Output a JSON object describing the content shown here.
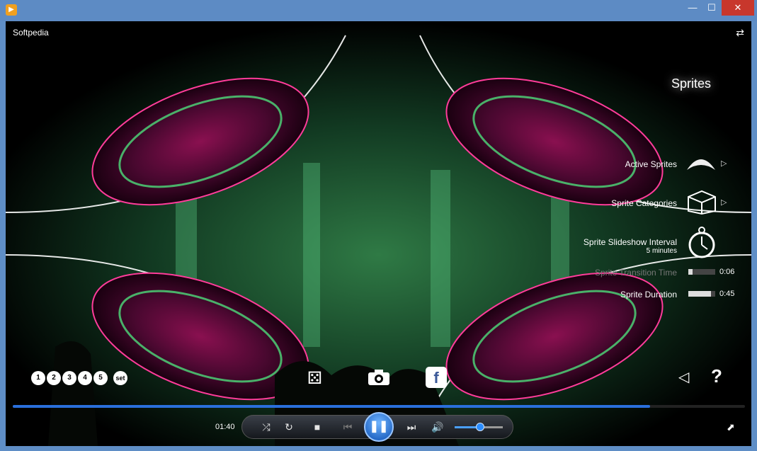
{
  "window": {
    "app_title": "Softpedia"
  },
  "panel": {
    "title": "Sprites",
    "active_sprites": "Active Sprites",
    "sprite_categories": "Sprite Categories",
    "slideshow_interval": "Sprite Slideshow Interval",
    "slideshow_interval_value": "5 minutes",
    "transition_time": "Sprite Transition Time",
    "transition_time_value": "0:06",
    "transition_fraction": 0.15,
    "duration": "Sprite Duration",
    "duration_value": "0:45",
    "duration_fraction": 0.85
  },
  "presets": [
    "1",
    "2",
    "3",
    "4",
    "5",
    "set"
  ],
  "player": {
    "elapsed": "01:40",
    "progress_fraction": 0.87,
    "volume_fraction": 0.5
  },
  "icons": {
    "fullscreen": "fullscreen-toggle-icon",
    "dice": "dice-icon",
    "camera": "camera-icon",
    "facebook": "facebook-icon",
    "back": "back-arrow-icon",
    "help": "help-icon",
    "expand": "expand-icon"
  },
  "colors": {
    "accent": "#2a6fdb",
    "aurora": "#2e7a44",
    "magenta": "#b0185e"
  }
}
